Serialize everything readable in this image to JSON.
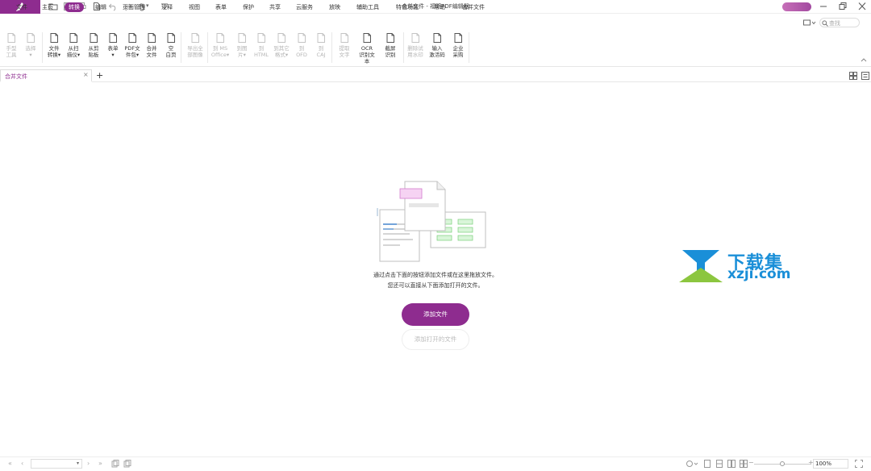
{
  "window": {
    "title": "合并文件 - 福昕PDF编辑器",
    "search_placeholder": "查找"
  },
  "menu": [
    {
      "label": "文件",
      "active": false
    },
    {
      "label": "主页",
      "active": false
    },
    {
      "label": "转换",
      "active": true
    },
    {
      "label": "编辑",
      "active": false
    },
    {
      "label": "页面管理",
      "active": false
    },
    {
      "label": "注释",
      "active": false
    },
    {
      "label": "视图",
      "active": false
    },
    {
      "label": "表单",
      "active": false
    },
    {
      "label": "保护",
      "active": false
    },
    {
      "label": "共享",
      "active": false
    },
    {
      "label": "云服务",
      "active": false
    },
    {
      "label": "放映",
      "active": false
    },
    {
      "label": "辅助工具",
      "active": false
    },
    {
      "label": "特色功能",
      "active": false
    },
    {
      "label": "帮助",
      "active": false
    },
    {
      "label": "合并文件",
      "active": false
    }
  ],
  "ribbon": [
    {
      "line1": "手型",
      "line2": "工具",
      "enabled": false,
      "icon": "hand-icon"
    },
    {
      "line1": "选择",
      "line2": "▾",
      "enabled": false,
      "icon": "select-icon"
    },
    {
      "line1": "文件",
      "line2": "转换▾",
      "enabled": true,
      "icon": "file-convert-icon"
    },
    {
      "line1": "从扫",
      "line2": "描仪▾",
      "enabled": true,
      "icon": "scanner-icon"
    },
    {
      "line1": "从剪",
      "line2": "贴板",
      "enabled": true,
      "icon": "clipboard-icon"
    },
    {
      "line1": "表单",
      "line2": "▾",
      "enabled": true,
      "icon": "form-icon"
    },
    {
      "line1": "PDF文",
      "line2": "件包▾",
      "enabled": true,
      "icon": "pdf-package-icon"
    },
    {
      "line1": "合并",
      "line2": "文件",
      "enabled": true,
      "icon": "merge-icon"
    },
    {
      "line1": "空",
      "line2": "白页",
      "enabled": true,
      "icon": "blank-page-icon"
    },
    {
      "line1": "导出全",
      "line2": "部图像",
      "enabled": false,
      "icon": "export-images-icon"
    },
    {
      "line1": "到 MS",
      "line2": "Office▾",
      "enabled": false,
      "icon": "to-office-icon"
    },
    {
      "line1": "到图",
      "line2": "片▾",
      "enabled": false,
      "icon": "to-image-icon"
    },
    {
      "line1": "到",
      "line2": "HTML",
      "enabled": false,
      "icon": "to-html-icon"
    },
    {
      "line1": "到其它",
      "line2": "格式▾",
      "enabled": false,
      "icon": "to-other-icon"
    },
    {
      "line1": "到",
      "line2": "OFD",
      "enabled": false,
      "icon": "to-ofd-icon"
    },
    {
      "line1": "到",
      "line2": "CAJ",
      "enabled": false,
      "icon": "to-caj-icon"
    },
    {
      "line1": "提取",
      "line2": "文字",
      "enabled": false,
      "icon": "extract-text-icon"
    },
    {
      "line1": "OCR",
      "line2": "识别文本",
      "enabled": true,
      "icon": "ocr-icon"
    },
    {
      "line1": "截屏",
      "line2": "识别",
      "enabled": true,
      "icon": "screenshot-ocr-icon"
    },
    {
      "line1": "删除试",
      "line2": "用水印",
      "enabled": false,
      "icon": "remove-watermark-icon"
    },
    {
      "line1": "输入",
      "line2": "激活码",
      "enabled": true,
      "icon": "activation-icon"
    },
    {
      "line1": "企业",
      "line2": "采购",
      "enabled": true,
      "icon": "enterprise-icon"
    }
  ],
  "tab": {
    "label": "合并文件",
    "close": "×",
    "add": "+"
  },
  "empty_state": {
    "line1": "通过点击下面的按钮添加文件或在这里拖放文件。",
    "line2": "您还可以直接从下面添加打开的文件。",
    "add_file": "添加文件",
    "add_open_files": "添加打开的文件"
  },
  "watermark": {
    "big": "下载集",
    "small": "xzji.com"
  },
  "status": {
    "zoom": "100%"
  },
  "colors": {
    "accent": "#8e2c8f",
    "watermark": "#1a8fd8"
  }
}
